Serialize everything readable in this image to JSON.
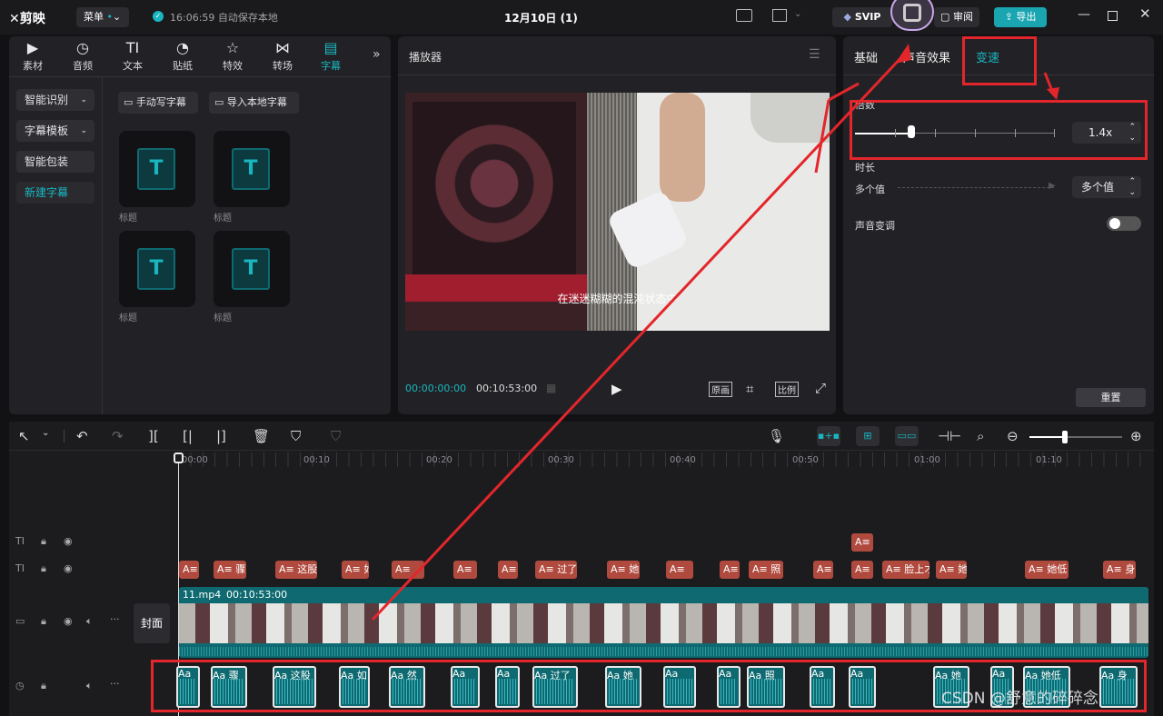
{
  "app": {
    "logo": "剪映",
    "menu": "菜单",
    "autosave": "16:06:59 自动保存本地",
    "title": "12月10日 (1)",
    "svip": "SVIP",
    "review": "审阅",
    "export": "导出"
  },
  "media_tabs": [
    "素材",
    "音频",
    "文本",
    "贴纸",
    "特效",
    "转场",
    "字幕"
  ],
  "sidebar": [
    "智能识别",
    "字幕模板",
    "智能包装",
    "新建字幕"
  ],
  "subtitle_actions": {
    "manual": "手动写字幕",
    "import": "导入本地字幕"
  },
  "templates": [
    "标题",
    "标题",
    "标题",
    "标题"
  ],
  "player": {
    "title": "播放器",
    "current_time": "00:00:00:00",
    "total_time": "00:10:53:00",
    "caption": "在迷迷糊糊的混沌状态中",
    "btn_original": "原画",
    "btn_ratio": "比例"
  },
  "props": {
    "tabs": [
      "基础",
      "声音效果",
      "变速"
    ],
    "multiplier_label": "倍数",
    "multiplier_value": "1.4x",
    "duration_label": "时长",
    "duration_from": "多个值",
    "duration_to": "多个值",
    "pitch_label": "声音变调",
    "reset": "重置",
    "speed_level": 0.14
  },
  "ruler": [
    "00:00",
    "00:10",
    "00:20",
    "00:30",
    "00:40",
    "00:50",
    "01:00",
    "01:10"
  ],
  "tracks": {
    "cover": "封面",
    "clip_name": "11.mp4",
    "clip_duration": "00:10:53:00"
  },
  "subtitle_chips": [
    "",
    "骤",
    "这股",
    "如",
    "",
    "",
    "",
    "过了",
    "她",
    "",
    "",
    "照",
    "",
    "",
    "脸上才",
    "她",
    "她低",
    "身"
  ],
  "audio_chips": [
    "",
    "骤",
    "这股",
    "如",
    "然",
    "",
    "",
    "过了",
    "她",
    "",
    "",
    "照",
    "",
    "",
    "",
    "她",
    "她低",
    "身"
  ],
  "watermark": "CSDN @舒意的碎碎念",
  "colors": {
    "accent": "#19b6c0",
    "annotation": "#e3262b",
    "subtitle_chip": "#b04a3e",
    "track": "#0e6a70"
  }
}
